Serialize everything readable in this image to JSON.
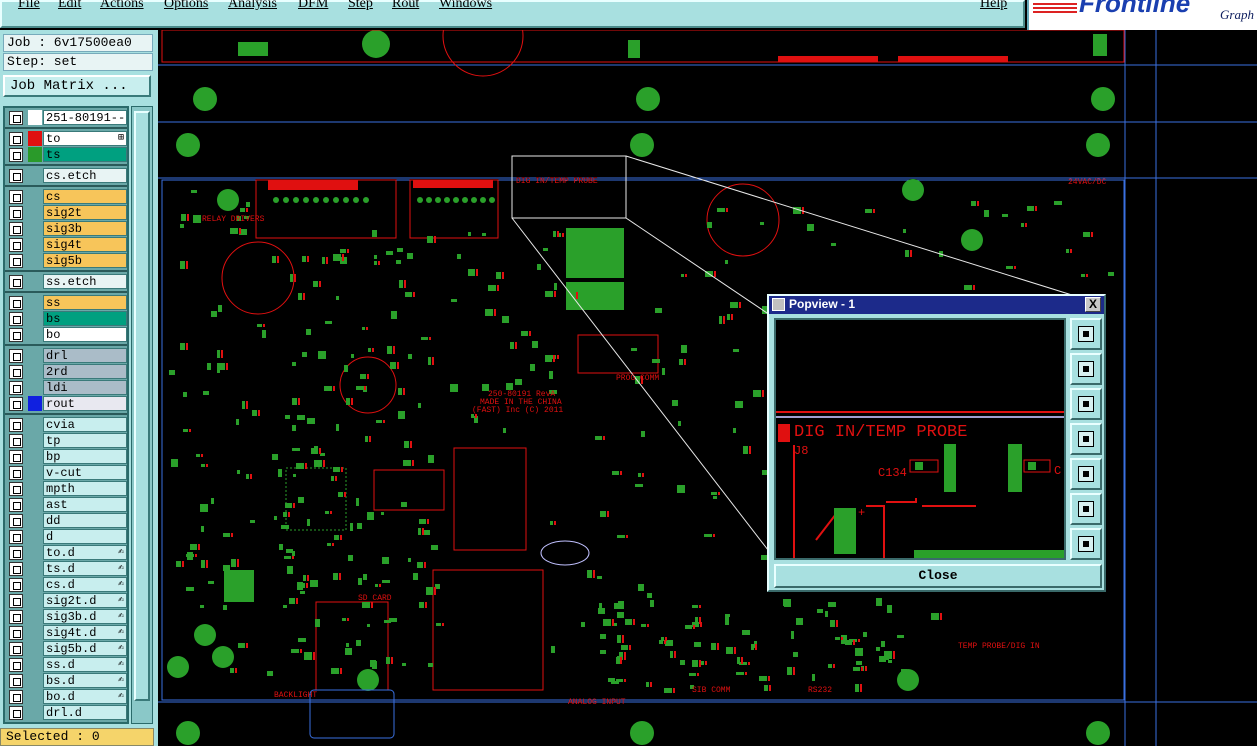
{
  "menu": {
    "items": [
      "File",
      "Edit",
      "Actions",
      "Options",
      "Analysis",
      "DFM",
      "Step",
      "Rout",
      "Windows",
      "Help"
    ]
  },
  "brand": {
    "logo_text": "Frontline",
    "sub_text": "Graph"
  },
  "job": {
    "job_label": "Job : 6v17500ea0",
    "step_label": "Step: set",
    "job_matrix_button": "Job Matrix ..."
  },
  "layers": [
    {
      "name": "251-80191---",
      "color": "#ffffff",
      "bg": "#ffffff"
    },
    {
      "name": "to",
      "color": "#e01010",
      "bg": "#ffffff",
      "extra": "⊞"
    },
    {
      "name": "ts",
      "color": "#2a9a2a",
      "bg": "#00a080"
    },
    {
      "name": "cs.etch",
      "color": "",
      "bg": "#e8f4f4"
    },
    {
      "name": "cs",
      "color": "",
      "bg": "#f7c55a"
    },
    {
      "name": "sig2t",
      "color": "",
      "bg": "#f7c55a"
    },
    {
      "name": "sig3b",
      "color": "",
      "bg": "#f7c55a"
    },
    {
      "name": "sig4t",
      "color": "",
      "bg": "#f7c55a"
    },
    {
      "name": "sig5b",
      "color": "",
      "bg": "#f7c55a"
    },
    {
      "name": "ss.etch",
      "color": "",
      "bg": "#e8f4f4"
    },
    {
      "name": "ss",
      "color": "",
      "bg": "#f7c55a"
    },
    {
      "name": "bs",
      "color": "",
      "bg": "#00a080"
    },
    {
      "name": "bo",
      "color": "",
      "bg": "#ffffff"
    },
    {
      "name": "drl",
      "color": "",
      "bg": "#aabcc8"
    },
    {
      "name": "2rd",
      "color": "",
      "bg": "#aabcc8"
    },
    {
      "name": "ldi",
      "color": "",
      "bg": "#aabcc8"
    },
    {
      "name": "rout",
      "color": "#1020e0",
      "bg": "#e8e8f0"
    },
    {
      "name": "cvia",
      "color": "",
      "bg": "#c8eeee"
    },
    {
      "name": "tp",
      "color": "",
      "bg": "#c8eeee"
    },
    {
      "name": "bp",
      "color": "",
      "bg": "#c8eeee"
    },
    {
      "name": "v-cut",
      "color": "",
      "bg": "#c8eeee"
    },
    {
      "name": "mpth",
      "color": "",
      "bg": "#c8eeee"
    },
    {
      "name": "ast",
      "color": "",
      "bg": "#c8eeee"
    },
    {
      "name": "dd",
      "color": "",
      "bg": "#c8eeee"
    },
    {
      "name": "d",
      "color": "",
      "bg": "#c8eeee"
    },
    {
      "name": "to.d",
      "color": "",
      "bg": "#c8eeee",
      "extra": "✍"
    },
    {
      "name": "ts.d",
      "color": "",
      "bg": "#c8eeee",
      "extra": "✍"
    },
    {
      "name": "cs.d",
      "color": "",
      "bg": "#c8eeee",
      "extra": "✍"
    },
    {
      "name": "sig2t.d",
      "color": "",
      "bg": "#c8eeee",
      "extra": "✍"
    },
    {
      "name": "sig3b.d",
      "color": "",
      "bg": "#c8eeee",
      "extra": "✍"
    },
    {
      "name": "sig4t.d",
      "color": "",
      "bg": "#c8eeee",
      "extra": "✍"
    },
    {
      "name": "sig5b.d",
      "color": "",
      "bg": "#c8eeee",
      "extra": "✍"
    },
    {
      "name": "ss.d",
      "color": "",
      "bg": "#c8eeee",
      "extra": "✍"
    },
    {
      "name": "bs.d",
      "color": "",
      "bg": "#c8eeee",
      "extra": "✍"
    },
    {
      "name": "bo.d",
      "color": "",
      "bg": "#c8eeee",
      "extra": "✍"
    },
    {
      "name": "drl.d",
      "color": "",
      "bg": "#c8eeee"
    }
  ],
  "status": {
    "selected": "Selected : 0"
  },
  "board": {
    "labels": [
      "RELAY DRIVERS",
      "DIG IN/TEMP PROBE",
      "250-80191 RevA",
      "MADE IN THE CHINA",
      "(FAST) Inc (C) 2011",
      "SD CARD",
      "BACKLIGHT",
      "SIB COMM",
      "RS232",
      "TEMP PROBE/DIG IN",
      "PROG COMM",
      "ANALOG INPUT",
      "24VAC/DC"
    ],
    "colors": {
      "copper": "#e01010",
      "pad": "#2aa02a",
      "outline": "#3a70e0",
      "bg": "#000000"
    }
  },
  "popview": {
    "title": "Popview - 1",
    "close_x": "X",
    "close_button": "Close",
    "zoom_labels": [
      "DIG IN/TEMP PROBE",
      "J8",
      "C134",
      "C"
    ]
  },
  "colors": {
    "panel": "#a8e0e0",
    "title_bar": "#1c2a8a",
    "status": "#f5d46a"
  }
}
